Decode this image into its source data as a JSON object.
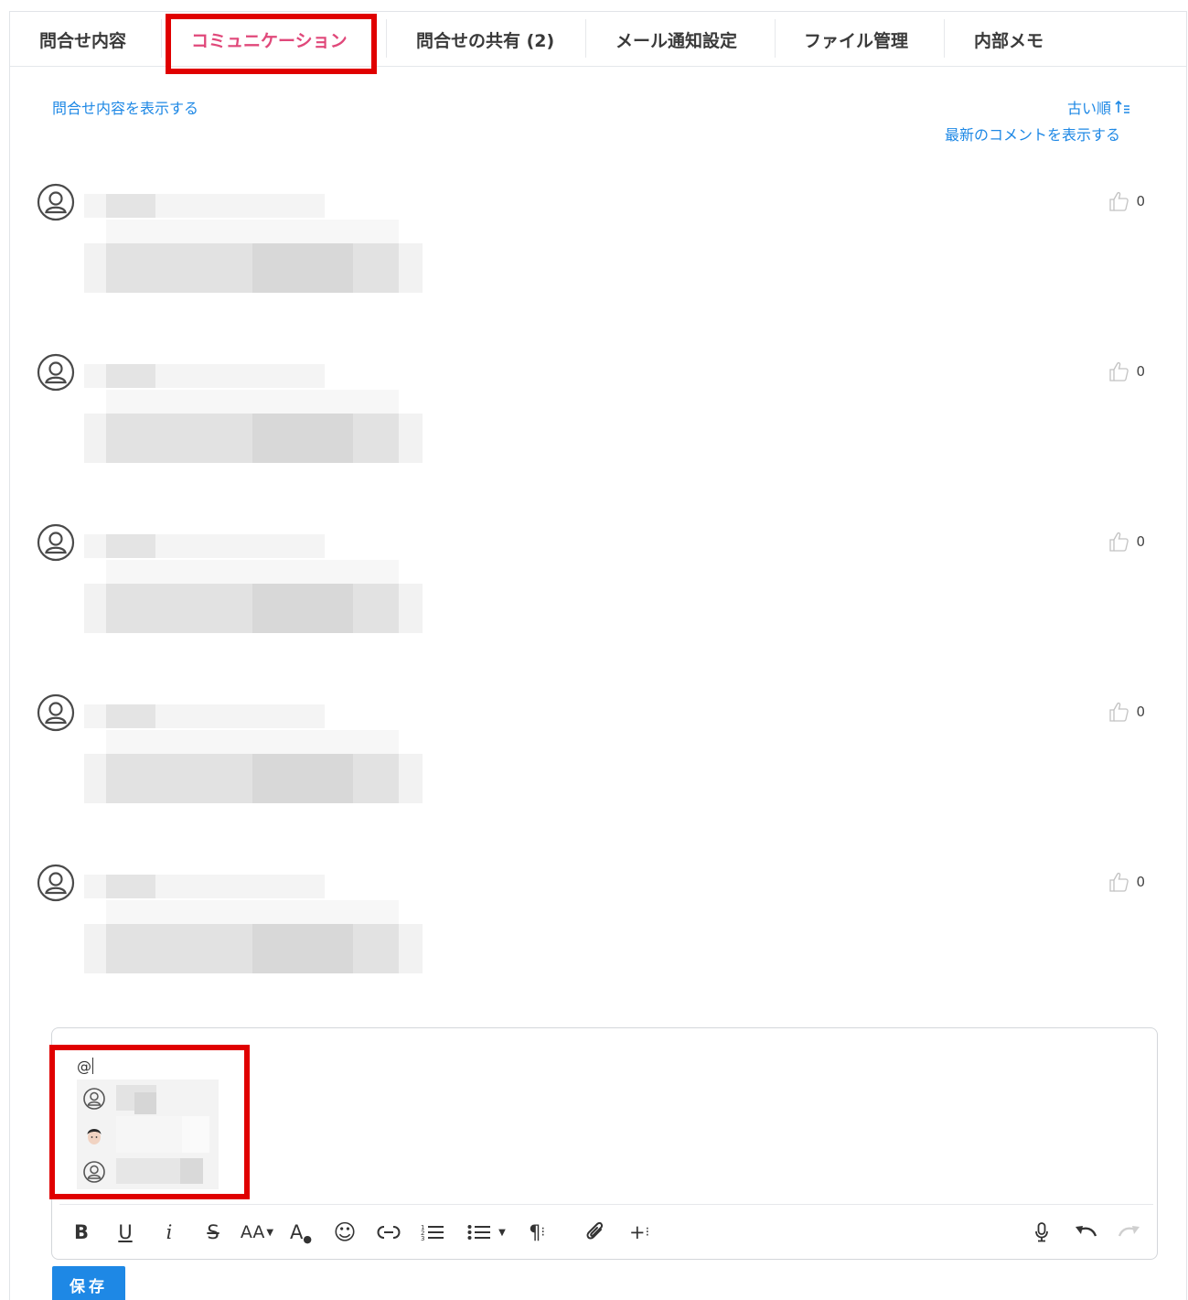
{
  "tabs": [
    {
      "label": "問合せ内容",
      "active": false
    },
    {
      "label": "コミュニケーション",
      "active": true
    },
    {
      "label": "問合せの共有 (2)",
      "active": false
    },
    {
      "label": "メール通知設定",
      "active": false
    },
    {
      "label": "ファイル管理",
      "active": false
    },
    {
      "label": "内部メモ",
      "active": false
    }
  ],
  "links": {
    "show_inquiry": "問合せ内容を表示する",
    "sort_order": "古い順",
    "sort_icon": "sort-ascending-icon",
    "show_latest": "最新のコメントを表示する"
  },
  "comments": [
    {
      "like_count": "0"
    },
    {
      "like_count": "0"
    },
    {
      "like_count": "0"
    },
    {
      "like_count": "0"
    },
    {
      "like_count": "0"
    }
  ],
  "editor": {
    "text": "@",
    "mention_candidates": [
      {
        "avatar": "user-placeholder-icon"
      },
      {
        "avatar": "user-photo"
      },
      {
        "avatar": "user-placeholder-icon"
      }
    ],
    "toolbar": {
      "bold": "B",
      "underline": "U",
      "italic": "i",
      "strike": "S",
      "font_size": "AA",
      "text_color": "A",
      "emoji": "☺",
      "link": "⊂⊃",
      "ordered_list": "≣",
      "unordered_list": "☰",
      "paragraph": "¶",
      "attach": "attach-icon",
      "insert": "+",
      "mic": "mic-icon",
      "undo": "undo-icon",
      "redo": "redo-icon"
    }
  },
  "save_button": "保存",
  "colors": {
    "active_tab": "#e0487a",
    "link": "#1e88e5",
    "highlight": "#e00000",
    "save_button": "#1e88e5"
  }
}
